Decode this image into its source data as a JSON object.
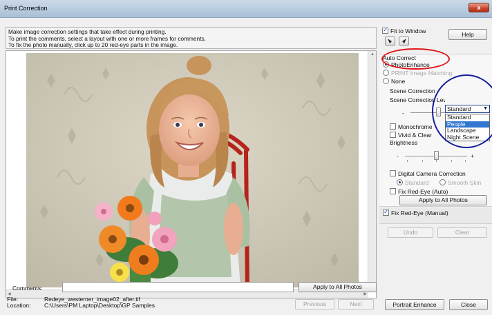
{
  "window": {
    "title": "Print Correction",
    "close_glyph": "x"
  },
  "instructions": [
    "Make image correction settings that take effect during printing.",
    "To print the comments, select a layout with one or more frames for comments.",
    "To fix the photo manually, click up to 20 red-eye parts in the image."
  ],
  "comments": {
    "label": "Comments:",
    "value": "",
    "apply_button": "Apply to All Photos"
  },
  "file": {
    "label": "File:",
    "value": "Redeye_westerner_image02_after.tif"
  },
  "location": {
    "label": "Location:",
    "value": "C:\\Users\\PM Laptop\\Desktop\\GP Samples"
  },
  "navigation": {
    "previous": "Previous",
    "next": "Next"
  },
  "right": {
    "fit_to_window": {
      "label": "Fit to Window",
      "checked": true
    },
    "help_button": "Help",
    "rotate_left_icon": "rotate-left-icon",
    "rotate_right_icon": "rotate-right-icon",
    "auto_correct": {
      "heading": "Auto Correct",
      "options": [
        "PhotoEnhance",
        "PRINT Image Matching",
        "None"
      ],
      "selected": "PhotoEnhance"
    },
    "scene_correction": {
      "label": "Scene Correction",
      "selected": "Standard",
      "options": [
        "Standard",
        "People",
        "Landscape",
        "Night Scene"
      ],
      "highlighted": "People"
    },
    "scene_level": {
      "label": "Scene Correction Level",
      "minus": "-",
      "plus": "+"
    },
    "monochrome": {
      "label": "Monochrome",
      "checked": false
    },
    "vivid_clear": {
      "label": "Vivid & Clear",
      "checked": false
    },
    "brightness": {
      "label": "Brightness",
      "minus": "-",
      "plus": "+"
    },
    "digital_camera": {
      "label": "Digital Camera Correction",
      "checked": false,
      "options": [
        "Standard",
        "Smooth Skin"
      ],
      "selected": "Standard"
    },
    "fix_redeye_auto": {
      "label": "Fix Red-Eye (Auto)",
      "checked": false
    },
    "apply_all_button": "Apply to All Photos",
    "fix_redeye_manual": {
      "label": "Fix Red-Eye (Manual)",
      "checked": true
    },
    "undo_button": "Undo",
    "clear_button": "Clear",
    "portrait_enhance_button": "Portrait Enhance",
    "close_button": "Close"
  },
  "colors": {
    "accent_blue": "#3076d0",
    "red_annotation": "#e0151a",
    "blue_annotation": "#151e9a",
    "titlebar": "#b9cce0"
  }
}
